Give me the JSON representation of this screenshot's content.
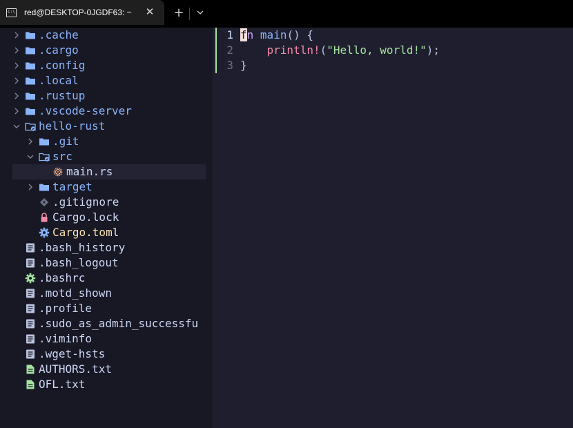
{
  "window": {
    "tab_title": "red@DESKTOP-0JGDF63: ~",
    "tab_icon_text": "C:\\",
    "close_glyph": "✕",
    "new_tab_glyph": "+",
    "dropdown_glyph": "⌄"
  },
  "tree": {
    "items": [
      {
        "label": ".cache",
        "kind": "folder",
        "state": "closed"
      },
      {
        "label": ".cargo",
        "kind": "folder",
        "state": "closed"
      },
      {
        "label": ".config",
        "kind": "folder",
        "state": "closed"
      },
      {
        "label": ".local",
        "kind": "folder",
        "state": "closed"
      },
      {
        "label": ".rustup",
        "kind": "folder",
        "state": "closed"
      },
      {
        "label": ".vscode-server",
        "kind": "folder",
        "state": "closed"
      },
      {
        "label": "hello-rust",
        "kind": "folder",
        "state": "open"
      },
      {
        "label": ".git",
        "kind": "folder",
        "state": "closed"
      },
      {
        "label": "src",
        "kind": "folder",
        "state": "open"
      },
      {
        "label": "main.rs",
        "kind": "rust-file",
        "selected": true
      },
      {
        "label": "target",
        "kind": "folder",
        "state": "closed"
      },
      {
        "label": ".gitignore",
        "kind": "git-file"
      },
      {
        "label": "Cargo.lock",
        "kind": "lock-file"
      },
      {
        "label": "Cargo.toml",
        "kind": "toml-file"
      },
      {
        "label": ".bash_history",
        "kind": "text-file"
      },
      {
        "label": ".bash_logout",
        "kind": "text-file"
      },
      {
        "label": ".bashrc",
        "kind": "config-file"
      },
      {
        "label": ".motd_shown",
        "kind": "text-file"
      },
      {
        "label": ".profile",
        "kind": "text-file"
      },
      {
        "label": ".sudo_as_admin_successfu",
        "kind": "text-file"
      },
      {
        "label": ".viminfo",
        "kind": "text-file"
      },
      {
        "label": ".wget-hsts",
        "kind": "text-file"
      },
      {
        "label": "AUTHORS.txt",
        "kind": "txt-file"
      },
      {
        "label": "OFL.txt",
        "kind": "txt-file"
      }
    ]
  },
  "editor": {
    "line_numbers": [
      "1",
      "2",
      "3"
    ],
    "lines": [
      {
        "cursor_char": "f",
        "kw_rest": "n",
        "space": " ",
        "fn_name": "main",
        "rest": "() {"
      },
      {
        "indent": "    ",
        "macro": "println!",
        "open": "(",
        "string": "\"Hello, world!\"",
        "close": ");"
      },
      {
        "text": "}"
      }
    ]
  },
  "colors": {
    "background": "#1e1e2e",
    "sidebar": "#181825",
    "folder": "#89b4fa",
    "keyword": "#cba6f7",
    "macro": "#f38ba8",
    "string": "#a6e3a1",
    "gutter_added": "#a6e3a1",
    "toml": "#f9e2af"
  }
}
